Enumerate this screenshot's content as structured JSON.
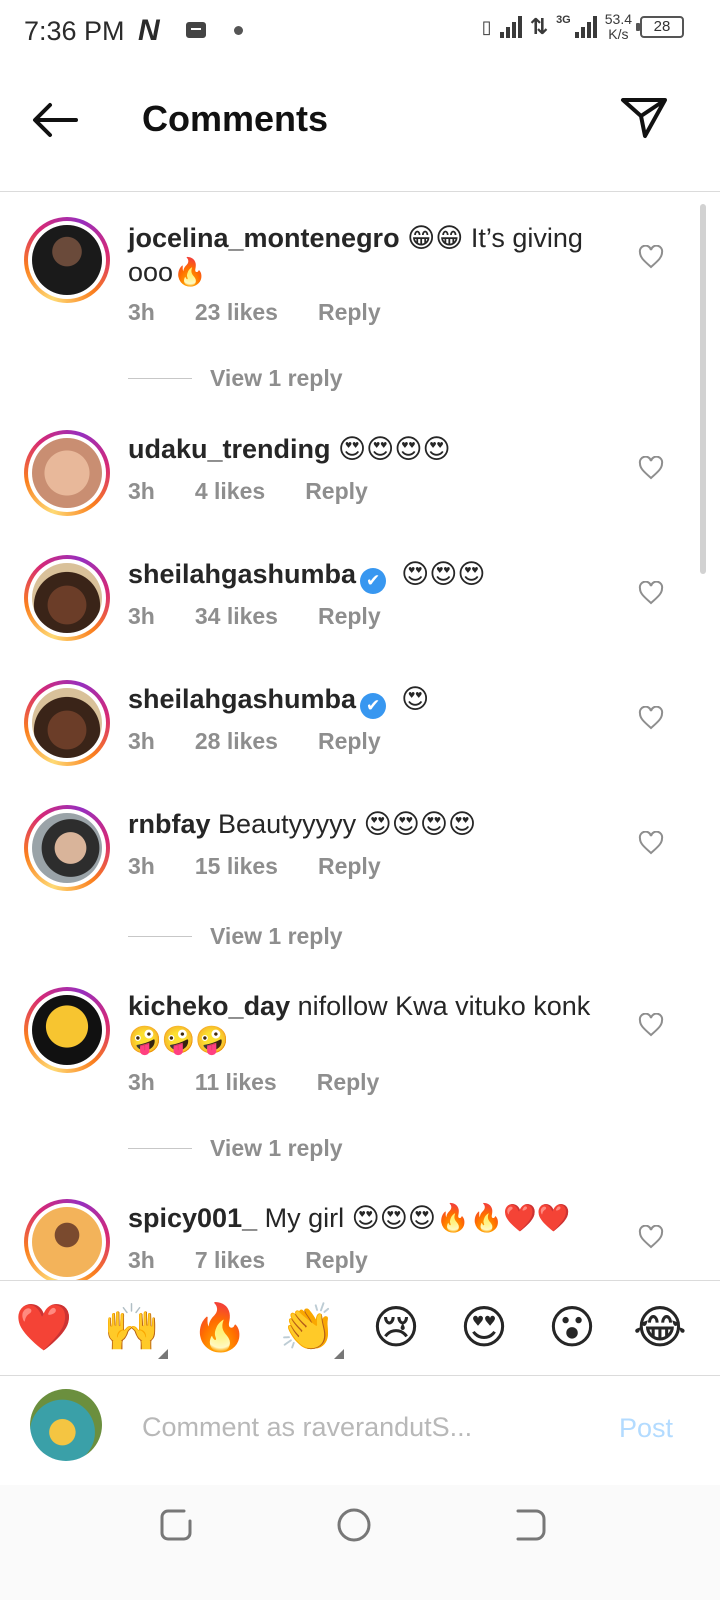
{
  "status_bar": {
    "time": "7:36 PM",
    "carrier_icon": "N",
    "network_type": "3G",
    "speed_value": "53.4",
    "speed_unit": "K/s",
    "battery": "28"
  },
  "header": {
    "title": "Comments",
    "back_icon": "arrow-left-icon",
    "share_icon": "send-icon"
  },
  "comments": [
    {
      "username": "jocelina_montenegro",
      "text": "😁😁 It’s giving ooo🔥",
      "time": "3h",
      "likes": "23 likes",
      "reply": "Reply",
      "view_replies": "View 1 reply",
      "verified": false
    },
    {
      "username": "udaku_trending",
      "text": "😍😍😍😍",
      "time": "3h",
      "likes": "4 likes",
      "reply": "Reply",
      "verified": false
    },
    {
      "username": "sheilahgashumba",
      "text": "😍😍😍",
      "time": "3h",
      "likes": "34 likes",
      "reply": "Reply",
      "verified": true
    },
    {
      "username": "sheilahgashumba",
      "text": "😍",
      "time": "3h",
      "likes": "28 likes",
      "reply": "Reply",
      "verified": true
    },
    {
      "username": "rnbfay",
      "text": "Beautyyyyy 😍😍😍😍",
      "time": "3h",
      "likes": "15 likes",
      "reply": "Reply",
      "view_replies": "View 1 reply",
      "verified": false
    },
    {
      "username": "kicheko_day",
      "text": "nifollow Kwa vituko konk 🤪🤪🤪",
      "time": "3h",
      "likes": "11 likes",
      "reply": "Reply",
      "view_replies": "View 1 reply",
      "verified": false
    },
    {
      "username": "spicy001_",
      "text": "My girl 😍😍😍🔥🔥❤️❤️",
      "time": "3h",
      "likes": "7 likes",
      "reply": "Reply",
      "verified": false
    }
  ],
  "verified_mark": "✔",
  "emoji_bar": [
    "❤️",
    "🙌",
    "🔥",
    "👏",
    "😢",
    "😍",
    "😮",
    "😂"
  ],
  "composer": {
    "placeholder": "Comment as raverandutS...",
    "post_label": "Post"
  },
  "colors": {
    "accent": "#0095f6",
    "post_disabled": "#b3dbff",
    "meta_gray": "#8e8e8e",
    "verified_blue": "#3897f0"
  }
}
